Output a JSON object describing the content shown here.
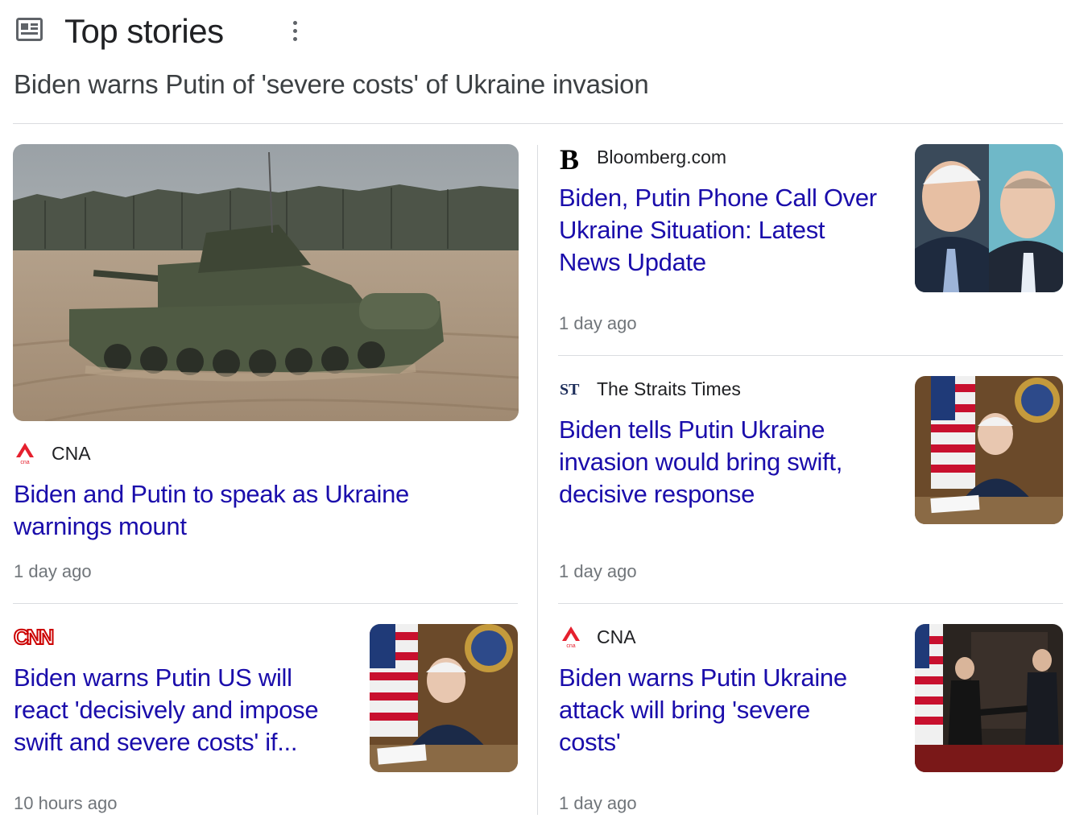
{
  "header": {
    "icon": "newspaper-icon",
    "title": "Top stories",
    "more_icon": "more-vert-icon"
  },
  "cluster_title": "Biden warns Putin of 'severe costs' of Ukraine invasion",
  "stories": [
    {
      "source": "CNA",
      "source_logo": "cna-logo",
      "headline_lines": [
        "Biden and Putin to speak as Ukraine",
        "warnings mount"
      ],
      "age": "1 day ago",
      "image": "tank-on-field-photo"
    },
    {
      "source": "Bloomberg.com",
      "source_logo": "bloomberg-logo",
      "headline_lines": [
        "Biden, Putin Phone Call Over",
        "Ukraine Situation: Latest",
        "News Update"
      ],
      "age": "1 day ago",
      "image": "biden-putin-photo"
    },
    {
      "source": "The Straits Times",
      "source_logo": "straits-times-logo",
      "headline_lines": [
        "Biden tells Putin Ukraine",
        "invasion would bring swift,",
        "decisive response"
      ],
      "age": "1 day ago",
      "image": "biden-desk-photo"
    },
    {
      "source": "CNN",
      "source_logo": "cnn-logo",
      "headline_lines": [
        "Biden warns Putin US will",
        "react 'decisively and impose",
        "swift and severe costs' if..."
      ],
      "age": "10 hours ago",
      "image": "biden-desk-photo"
    },
    {
      "source": "CNA",
      "source_logo": "cna-logo",
      "headline_lines": [
        "Biden warns Putin Ukraine",
        "attack will bring 'severe",
        "costs'"
      ],
      "age": "1 day ago",
      "image": "biden-putin-handshake-photo"
    }
  ],
  "colors": {
    "headline": "#1a0dab",
    "meta": "#70757a",
    "cnn_red": "#cc0000",
    "cna_red": "#e5202e",
    "divider": "#dadce0"
  }
}
